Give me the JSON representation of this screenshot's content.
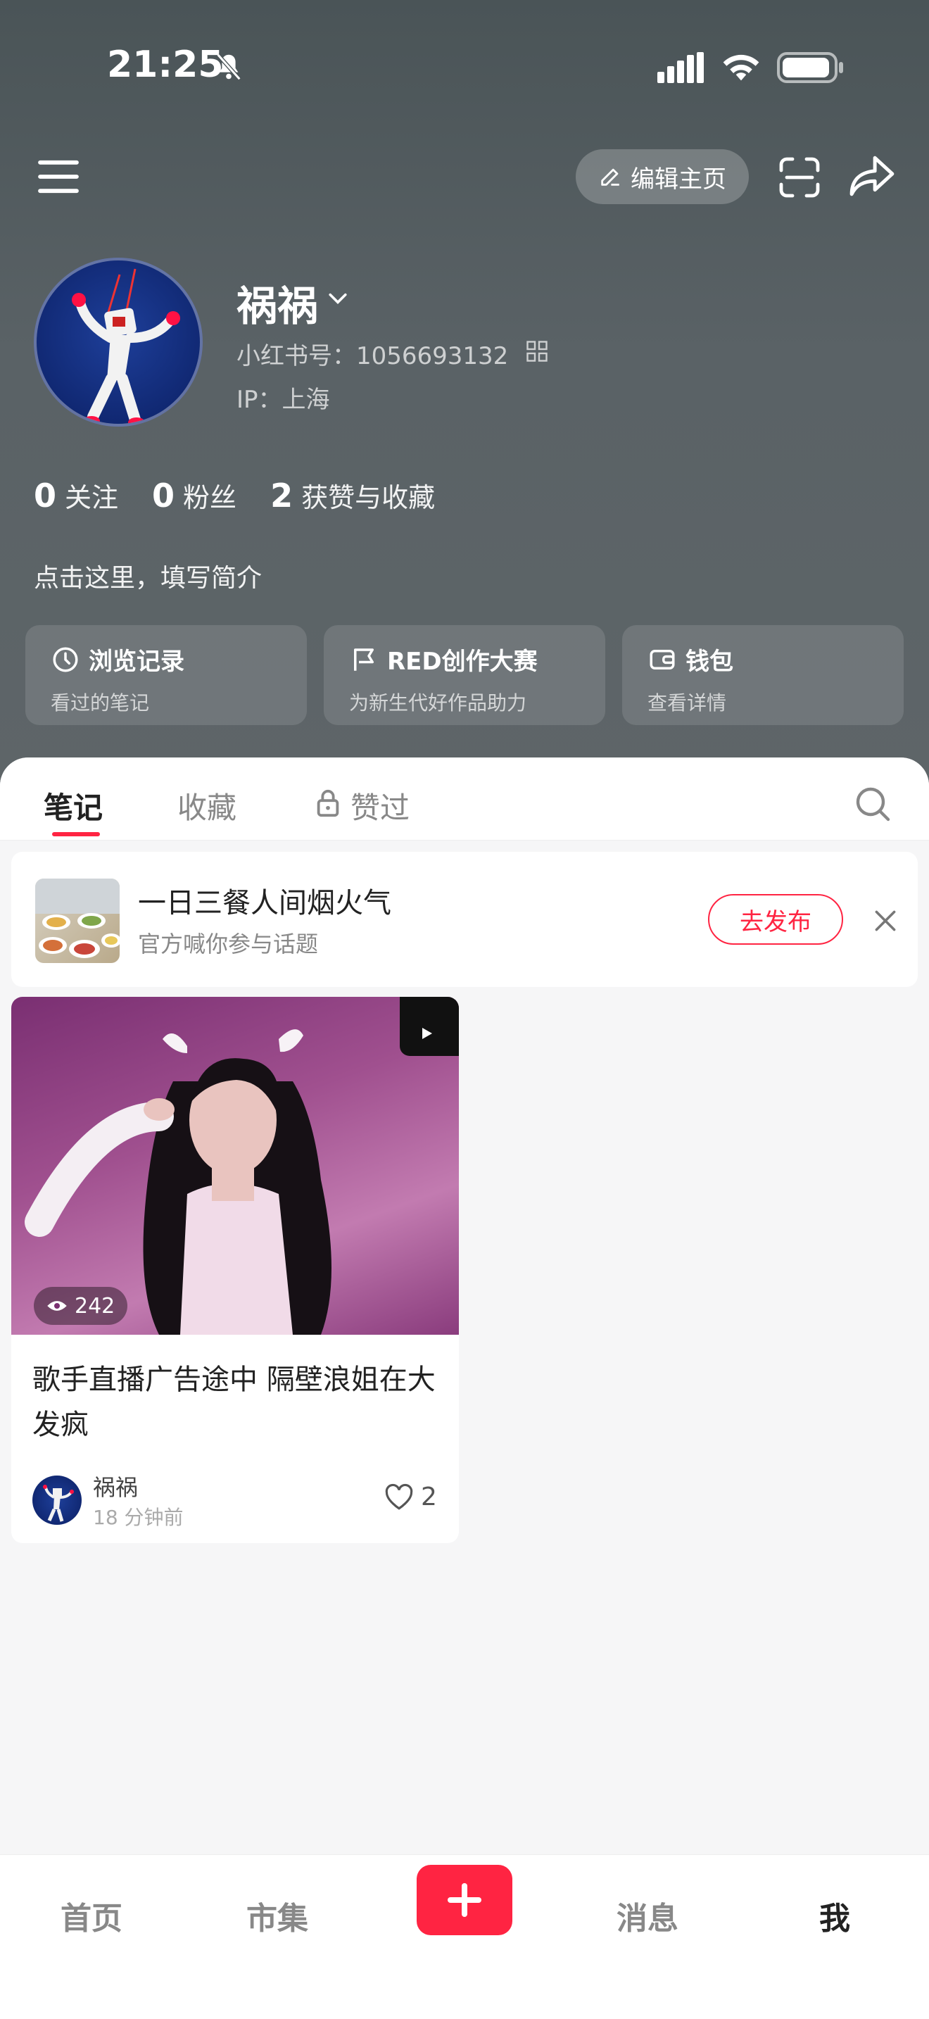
{
  "status_bar": {
    "time": "21:25"
  },
  "header": {
    "edit_label": "编辑主页"
  },
  "profile": {
    "username": "祸祸",
    "red_id": "小红书号：1056693132",
    "ip": "IP：上海",
    "bio": "点击这里，填写简介"
  },
  "stats": [
    {
      "num": "0",
      "label": "关注"
    },
    {
      "num": "0",
      "label": "粉丝"
    },
    {
      "num": "2",
      "label": "获赞与收藏"
    }
  ],
  "quick_cards": [
    {
      "title": "浏览记录",
      "sub": "看过的笔记",
      "icon": "clock-icon"
    },
    {
      "title": "RED创作大赛",
      "sub": "为新生代好作品助力",
      "icon": "flag-icon"
    },
    {
      "title": "钱包",
      "sub": "查看详情",
      "icon": "wallet-icon"
    }
  ],
  "tabs": [
    {
      "label": "笔记",
      "active": true
    },
    {
      "label": "收藏",
      "active": false
    },
    {
      "label": "赞过",
      "active": false
    }
  ],
  "topic": {
    "title": "一日三餐人间烟火气",
    "sub": "官方喊你参与话题",
    "button": "去发布"
  },
  "note": {
    "views": "242",
    "title": "歌手直播广告途中 隔壁浪姐在大发疯",
    "author": "祸祸",
    "time": "18 分钟前",
    "likes": "2"
  },
  "bottom_nav": [
    {
      "label": "首页"
    },
    {
      "label": "市集"
    },
    {
      "label": "消息"
    },
    {
      "label": "我"
    }
  ],
  "colors": {
    "accent": "#ff2442",
    "header_bg": "#535b5e"
  }
}
